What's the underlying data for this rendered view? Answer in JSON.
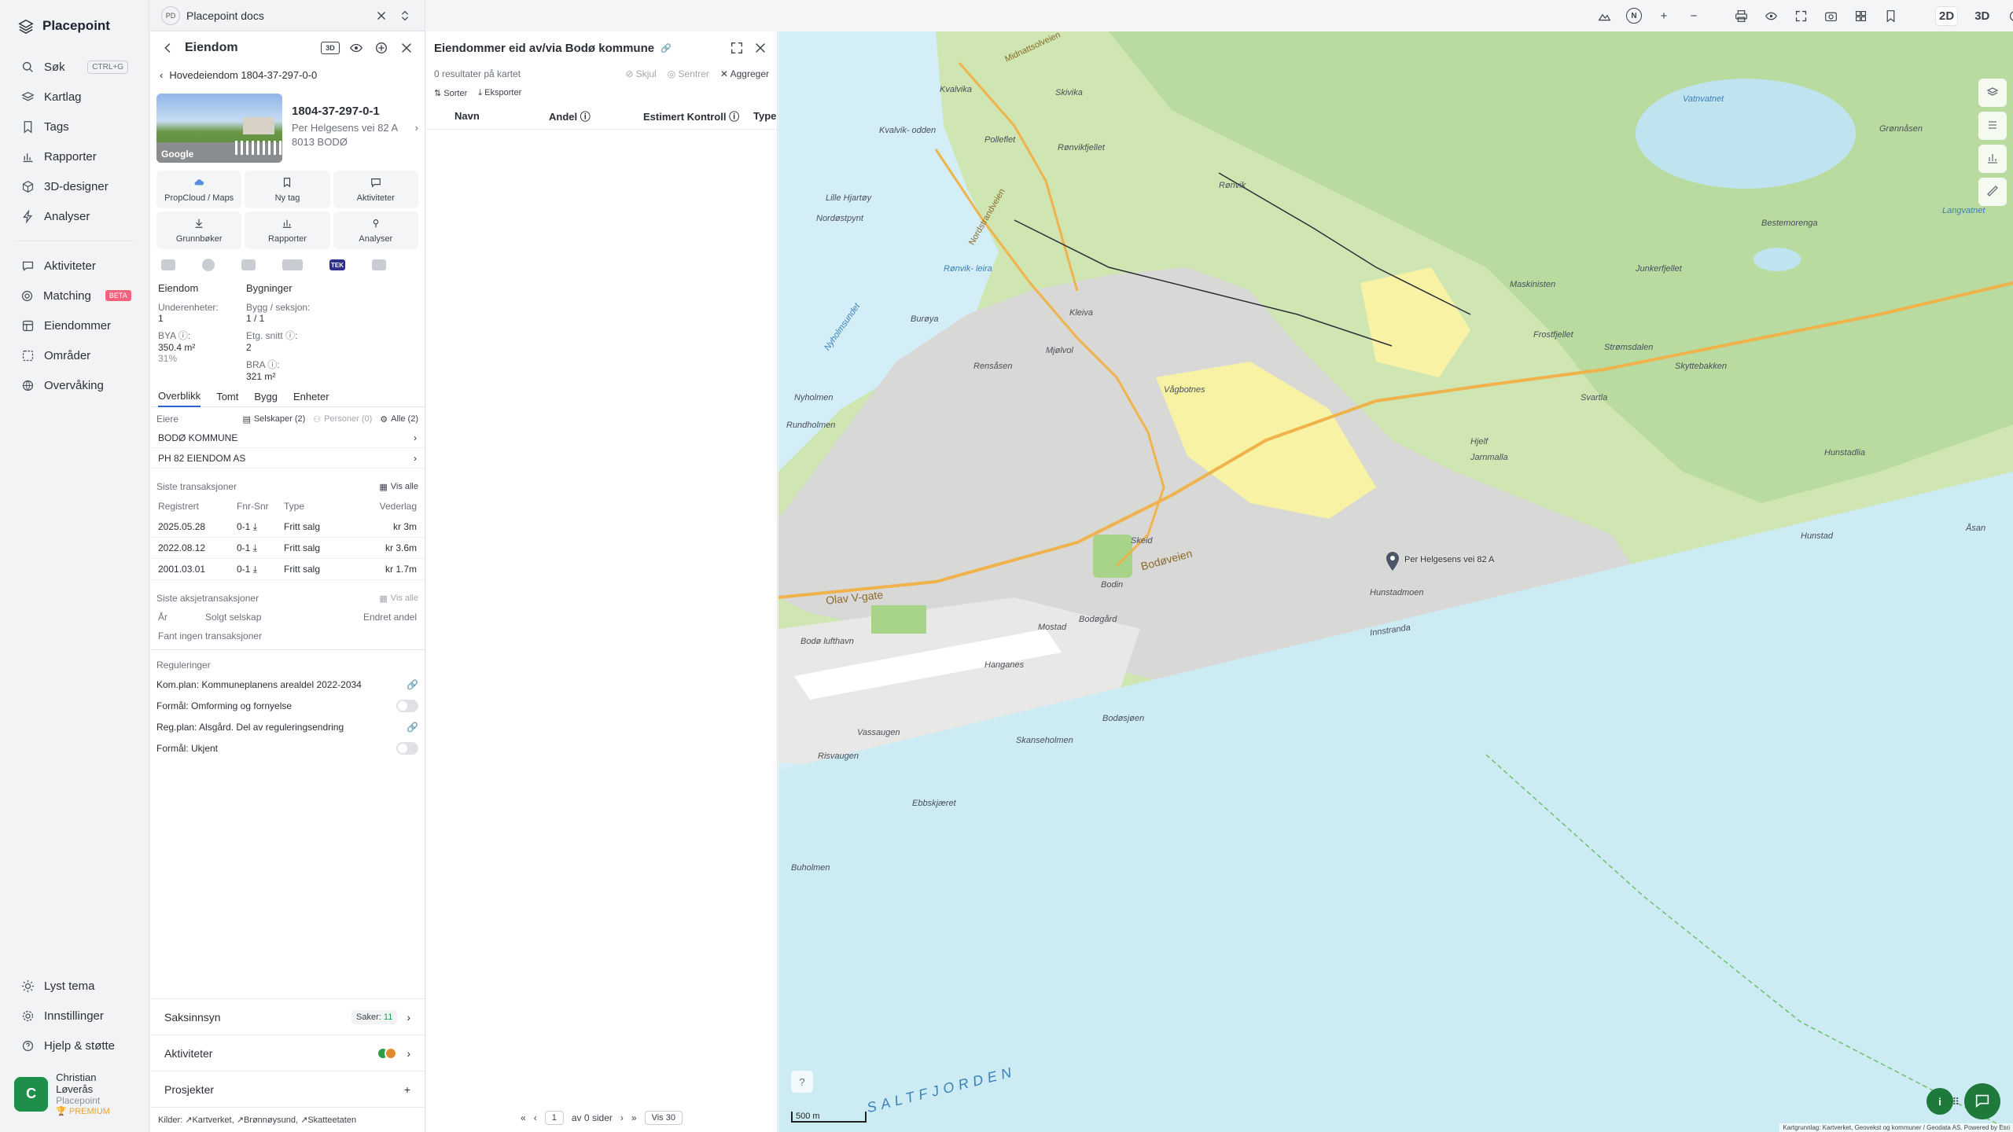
{
  "app": {
    "name": "Placepoint"
  },
  "nav": {
    "items": [
      {
        "label": "Søk",
        "shortcut": "CTRL+G"
      },
      {
        "label": "Kartlag"
      },
      {
        "label": "Tags"
      },
      {
        "label": "Rapporter"
      },
      {
        "label": "3D-designer"
      },
      {
        "label": "Analyser"
      },
      {
        "label": "Aktiviteter"
      },
      {
        "label": "Matching",
        "badge": "BETA"
      },
      {
        "label": "Eiendommer"
      },
      {
        "label": "Områder"
      },
      {
        "label": "Overvåking"
      }
    ],
    "bottom": [
      {
        "label": "Lyst tema"
      },
      {
        "label": "Innstillinger"
      },
      {
        "label": "Hjelp & støtte"
      }
    ],
    "user": {
      "initial": "C",
      "name": "Christian Løverås",
      "org": "Placepoint",
      "plan": "PREMIUM"
    }
  },
  "doc": {
    "initials": "PD",
    "name": "Placepoint docs"
  },
  "property": {
    "header": "Eiendom",
    "badge3d": "3D",
    "breadcrumb": "Hovedeiendom 1804-37-297-0-0",
    "id": "1804-37-297-0-1",
    "street": "Per Helgesens vei 82 A",
    "city": "8013 BODØ",
    "thumb_label": "Google",
    "actions": [
      "PropCloud / Maps",
      "Ny tag",
      "Aktiviteter",
      "Grunnbøker",
      "Rapporter",
      "Analyser"
    ],
    "tek_label": "TEK",
    "facts": {
      "eiendom_h": "Eiendom",
      "bygninger_h": "Bygninger",
      "underenheter_lbl": "Underenheter:",
      "underenheter_val": "1",
      "bygg_lbl": "Bygg / seksjon:",
      "bygg_val": "1 / 1",
      "bya_lbl": "BYA ⓘ:",
      "bya_val": "350.4 m²",
      "bya_pct": "31%",
      "etg_lbl": "Etg. snitt ⓘ:",
      "etg_val": "2",
      "bra_lbl": "BRA ⓘ:",
      "bra_val": "321 m²"
    },
    "tabs": [
      "Overblikk",
      "Tomt",
      "Bygg",
      "Enheter"
    ],
    "owners": {
      "title": "Eiere",
      "filters": [
        "Selskaper (2)",
        "Personer (0)",
        "Alle (2)"
      ],
      "list": [
        "BODØ KOMMUNE",
        "PH 82 EIENDOM AS"
      ]
    },
    "transactions": {
      "title": "Siste transaksjoner",
      "show_all": "Vis alle",
      "headers": [
        "Registrert",
        "Fnr-Snr",
        "Type",
        "Vederlag"
      ],
      "rows": [
        {
          "date": "2025.05.28",
          "snr": "0-1",
          "type": "Fritt salg",
          "amount": "kr 3m"
        },
        {
          "date": "2022.08.12",
          "snr": "0-1",
          "type": "Fritt salg",
          "amount": "kr 3.6m"
        },
        {
          "date": "2001.03.01",
          "snr": "0-1",
          "type": "Fritt salg",
          "amount": "kr 1.7m"
        }
      ]
    },
    "share_tx": {
      "title": "Siste aksjetransaksjoner",
      "show_all": "Vis alle",
      "headers": [
        "År",
        "Solgt selskap",
        "Endret andel"
      ],
      "empty": "Fant ingen transaksjoner"
    },
    "regulations": {
      "title": "Reguleringer",
      "items": [
        {
          "text": "Kom.plan: Kommuneplanens arealdel 2022-2034",
          "control": "link"
        },
        {
          "text": "Formål: Omforming og fornyelse",
          "control": "toggle"
        },
        {
          "text": "Reg.plan: Alsgård. Del av reguleringsendring",
          "control": "link"
        },
        {
          "text": "Formål: Ukjent",
          "control": "toggle"
        }
      ]
    },
    "footer": {
      "saksinnsyn": "Saksinnsyn",
      "saker_label": "Saker:",
      "saker_count": "11",
      "aktiviteter": "Aktiviteter",
      "prosjekter": "Prosjekter",
      "sources_label": "Kilder:",
      "sources": [
        "Kartverket,",
        "Brønnøysund,",
        "Skatteetaten"
      ]
    }
  },
  "results": {
    "title": "Eiendommer eid av/via Bodø kommune",
    "count_text": "0 resultater på kartet",
    "hide": "Skjul",
    "center": "Sentrer",
    "aggregate": "Aggreger",
    "sort": "Sorter",
    "export": "Eksporter",
    "columns": [
      "Navn",
      "Andel ⓘ",
      "Estimert Kontroll ⓘ",
      "Type"
    ],
    "pager": {
      "page": "1",
      "of_text": "av 0 sider",
      "per_page": "Vis 30"
    }
  },
  "map": {
    "modes": [
      "2D",
      "3D"
    ],
    "active_mode": "2D",
    "north": "N",
    "scale": "500 m",
    "attribution": "Kartgrunnlag: Kartverket, Geovekst og kommuner / Geodata AS. Powered by Esri",
    "labels": {
      "midnattsolveien": "Midnattsolveien",
      "kvalvika": "Kvalvika",
      "polleflet": "Polleflet",
      "skivika": "Skivika",
      "ronvikfjellet": "Rønvikfjellet",
      "ronvik": "Rønvik",
      "kvalvikodden": "Kvalvik-\nodden",
      "lillehjartoy": "Lille Hjartøy",
      "nordostpynt": "Nordøstpynt",
      "nordstrandveien": "Nordstrandveien",
      "ronvikleira": "Rønvik-\nleira",
      "burøya": "Burøya",
      "nyholmsundet": "Nyholmsundet",
      "nyholmen": "Nyholmen",
      "rundholmen": "Rundholmen",
      "rensasen": "Rensåsen",
      "mjolvol": "Mjølvol",
      "kleiva": "Kleiva",
      "vaagbotnes": "Vågbotnes",
      "olavvgate": "Olav V-gate",
      "bodolufthavn": "Bodø lufthavn",
      "hanganes": "Hanganes",
      "vassaugen": "Vassaugen",
      "risvaugen": "Risvaugen",
      "skanseholmen": "Skanseholmen",
      "bodosjoen": "Bodøsjøen",
      "ebbskjaeret": "Ebbskjæret",
      "buholmen": "Buholmen",
      "bodoveien": "Bodøveien",
      "mostad": "Mostad",
      "bodogard": "Bodøgård",
      "bodin": "Bodin",
      "skeid": "Skeid",
      "hunstadmoen": "Hunstadmoen",
      "innstranda": "Innstranda",
      "saltfjorden": "SALTFJORDEN",
      "asan": "Åsan",
      "hunstad": "Hunstad",
      "hunstadlia": "Hunstadlia",
      "skyttebakken": "Skyttebakken",
      "svartla": "Svartla",
      "frostfjellet": "Frostfjellet",
      "maskinisten": "Maskinisten",
      "junkerfjellet": "Junkerfjellet",
      "bestemorenga": "Bestemorenga",
      "grannasen": "Grønnåsen",
      "vatnvatnet": "Vatnvatnet",
      "langvatnet": "Langvatnet",
      "mjelle": "Hjelf",
      "jarnmalla": "Jarnmalla",
      "stromsdalen": "Strømsdalen",
      "pinname": "Per Helgesens vei 82 A"
    }
  }
}
